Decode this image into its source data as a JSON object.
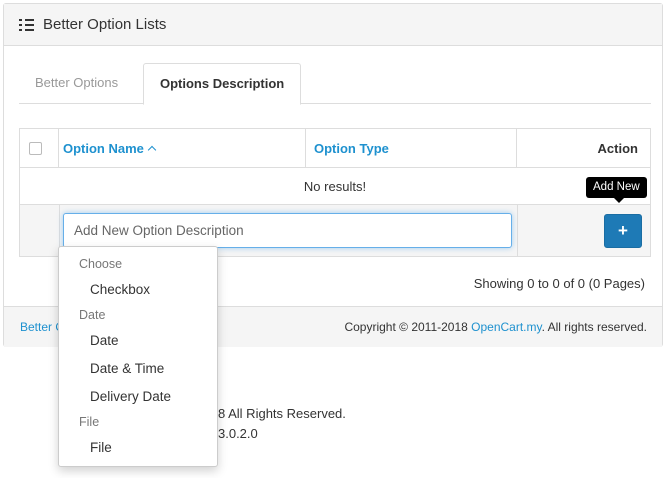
{
  "panel": {
    "title": "Better Option Lists"
  },
  "tabs": [
    {
      "label": "Better Options"
    },
    {
      "label": "Options Description"
    }
  ],
  "table": {
    "columns": {
      "name": "Option Name",
      "type": "Option Type",
      "action": "Action"
    },
    "empty_text": "No results!",
    "new_input": {
      "placeholder": "Add New Option Description",
      "value": ""
    },
    "add_button": {
      "label": "+",
      "tooltip": "Add New"
    }
  },
  "pagination": {
    "text": "Showing 0 to 0 of 0 (0 Pages)"
  },
  "footer": {
    "left_text": "Better O",
    "copyright": "Copyright © 2011-2018 ",
    "link": "OpenCart.my",
    "suffix": ". All rights reserved."
  },
  "page_footer": {
    "line1": "8 All Rights Reserved.",
    "line2": "3.0.2.0"
  },
  "dropdown": {
    "groups": [
      {
        "header": "Choose",
        "items": [
          "Checkbox"
        ]
      },
      {
        "header": "Date",
        "items": [
          "Date",
          "Date & Time",
          "Delivery Date"
        ]
      },
      {
        "header": "File",
        "items": [
          "File"
        ]
      }
    ]
  },
  "colors": {
    "link": "#1e91cf",
    "primary_button": "#1e7ab6",
    "heading_bg": "#f5f5f5"
  },
  "icons": {
    "panel_title_icon": "list-icon",
    "sort_indicator": "caret-up-icon"
  }
}
